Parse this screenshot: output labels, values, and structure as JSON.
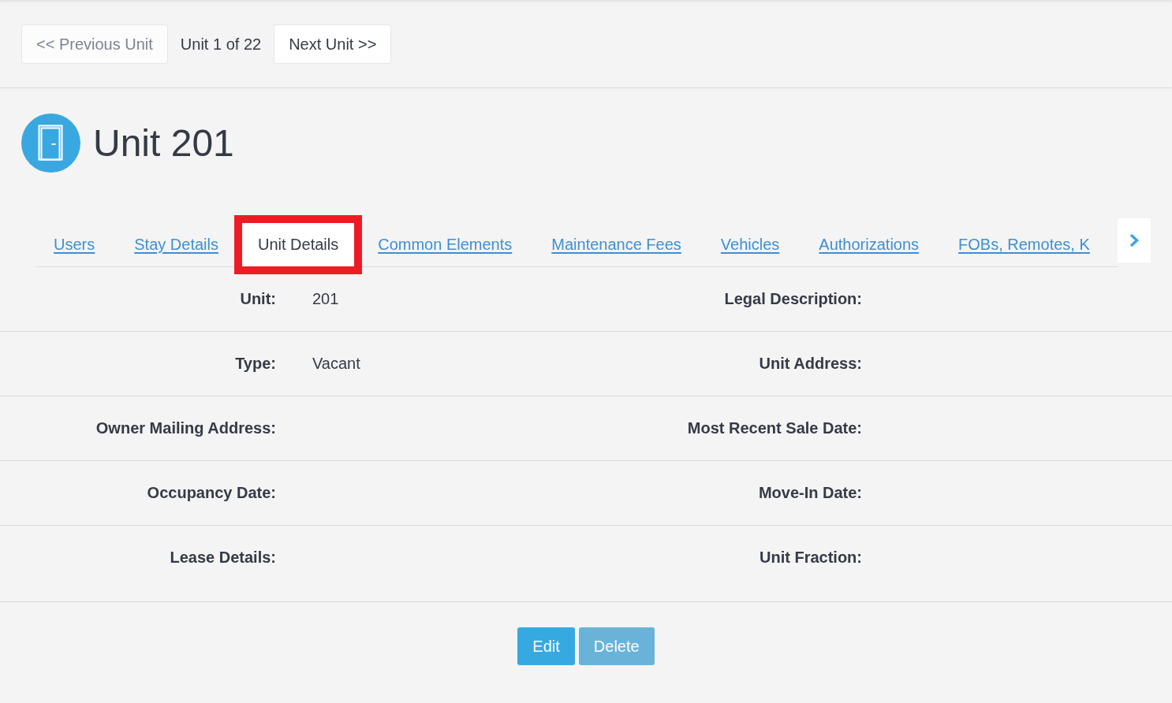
{
  "pager": {
    "previous": {
      "label": "<< Previous Unit",
      "disabled": true
    },
    "position": "Unit 1 of 22",
    "next": {
      "label": "Next Unit >>",
      "disabled": false
    }
  },
  "header": {
    "title": "Unit 201"
  },
  "tabs": [
    {
      "label": "Users",
      "selected": false,
      "highlighted": false
    },
    {
      "label": "Stay Details",
      "selected": false,
      "highlighted": false
    },
    {
      "label": "Unit Details",
      "selected": true,
      "highlighted": true
    },
    {
      "label": "Common Elements",
      "selected": false,
      "highlighted": false
    },
    {
      "label": "Maintenance Fees",
      "selected": false,
      "highlighted": false
    },
    {
      "label": "Vehicles",
      "selected": false,
      "highlighted": false
    },
    {
      "label": "Authorizations",
      "selected": false,
      "highlighted": false
    },
    {
      "label": "FOBs, Remotes, K",
      "selected": false,
      "highlighted": false
    }
  ],
  "details": {
    "rows": [
      {
        "fields": [
          {
            "label": "Unit:",
            "value": "201"
          },
          {
            "label": "Legal Description:"
          }
        ]
      },
      {
        "fields": [
          {
            "label": "Type:",
            "value": "Vacant"
          },
          {
            "label": "Unit Address:"
          }
        ]
      },
      {
        "fields": [
          {
            "label": "Owner Mailing Address:"
          },
          {
            "label": "Most Recent Sale Date:"
          }
        ]
      },
      {
        "fields": [
          {
            "label": "Occupancy Date:"
          },
          {
            "label": "Move-In Date:"
          }
        ]
      },
      {
        "fields": [
          {
            "label": "Lease Details:"
          },
          {
            "label": "Unit Fraction:"
          }
        ]
      }
    ]
  },
  "actions": [
    {
      "label": "Edit",
      "disabled": false
    },
    {
      "label": "Delete",
      "disabled": true
    }
  ]
}
